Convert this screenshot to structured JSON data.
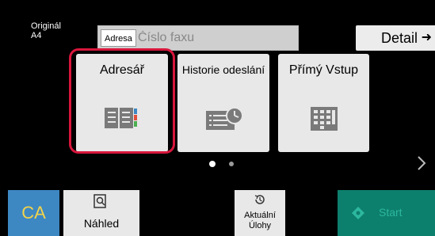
{
  "header": {
    "original_label": "Originál",
    "paper_size": "A4",
    "address_tag": "Adresa",
    "fax_placeholder": "Číslo faxu",
    "detail_label": "Detail",
    "detail_arrow": "➜"
  },
  "tiles": [
    {
      "label": "Adresář",
      "icon": "address-book-icon",
      "selected": true
    },
    {
      "label": "Historie odeslání",
      "icon": "send-history-icon"
    },
    {
      "label": "Přímý Vstup",
      "icon": "keypad-icon"
    }
  ],
  "pager": {
    "current_page": 1,
    "page_count": 2
  },
  "bottom": {
    "ca_label": "CA",
    "preview_label": "Náhled",
    "jobs_label_line1": "Aktuální",
    "jobs_label_line2": "Úlohy",
    "start_label": "Start"
  },
  "colors": {
    "highlight": "#d8163c",
    "ca_bg": "#3d88c3",
    "ca_text": "#f3d34a",
    "start_bg": "#0d7f6d",
    "start_text": "#2cb89e",
    "icon_gray": "#7a7a7a"
  }
}
